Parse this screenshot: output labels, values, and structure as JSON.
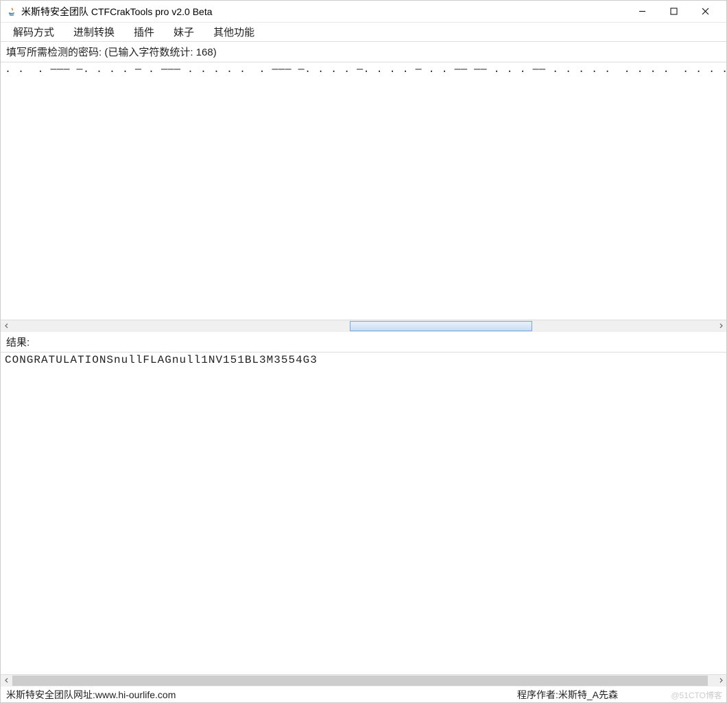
{
  "window": {
    "title": "米斯特安全团队 CTFCrakTools pro v2.0 Beta"
  },
  "menu": {
    "items": [
      "解码方式",
      "进制转换",
      "插件",
      "妹子",
      "其他功能"
    ]
  },
  "input": {
    "label": "填写所需检测的密码:  (已输入字符数统计: 168)",
    "value": ". .  . ——— —. . . . — . ——— . . . . .  . ——— —. . . . —. . . . — . . —— —— . . . —— . . . . .  . . . .  . . . . —  ——. . . . ——"
  },
  "result": {
    "label": "结果:",
    "value": "CONGRATULATIONSnullFLAGnull1NV151BL3M3554G3"
  },
  "scrollbar": {
    "input_thumb_left_pct": 48,
    "input_thumb_width_pct": 26,
    "result_thumb_left_pct": 0,
    "result_thumb_width_pct": 99
  },
  "status": {
    "left": "米斯特安全团队网址:www.hi-ourlife.com",
    "right": "程序作者:米斯特_A先森"
  },
  "watermark": "@51CTO博客"
}
